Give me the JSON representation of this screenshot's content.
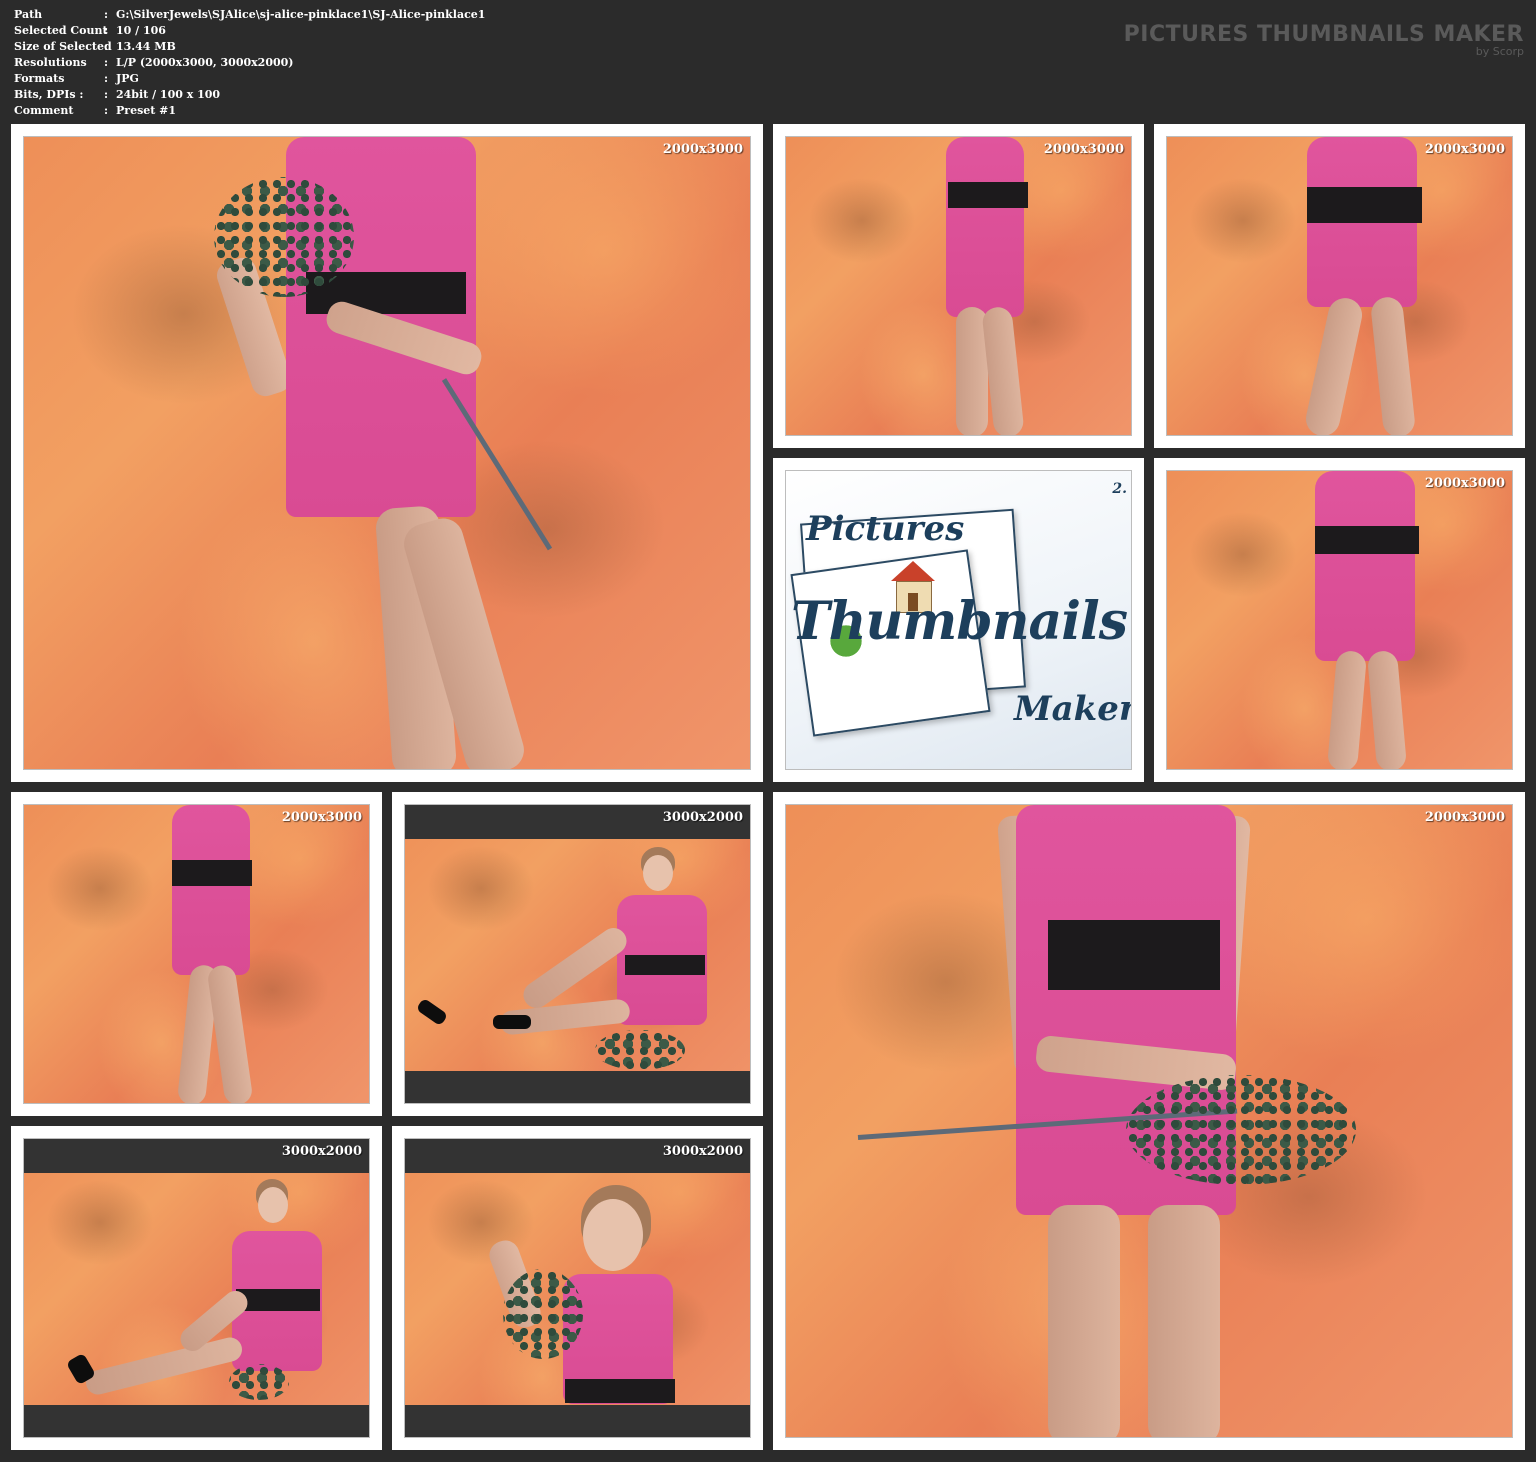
{
  "info": {
    "rows": [
      {
        "key": "Path",
        "value": "G:\\SilverJewels\\SJAlice\\sj-alice-pinklace1\\SJ-Alice-pinklace1"
      },
      {
        "key": "Selected Count",
        "value": "10 / 106"
      },
      {
        "key": "Size of Selected",
        "value": "13.44 MB"
      },
      {
        "key": "Resolutions",
        "value": "L/P (2000x3000, 3000x2000)"
      },
      {
        "key": "Formats",
        "value": "JPG"
      },
      {
        "key": "Bits, DPIs :",
        "value": "24bit / 100 x 100"
      },
      {
        "key": "Comment",
        "value": "Preset #1"
      }
    ],
    "separator": ":"
  },
  "brand": {
    "title": "PICTURES THUMBNAILS MAKER",
    "subtitle": "by Scorp"
  },
  "logo": {
    "line1": "Pictures",
    "line2": "Thumbnails",
    "line3": "Maker",
    "version": "2."
  },
  "thumbnails": [
    {
      "resolution": "2000x3000"
    },
    {
      "resolution": "2000x3000"
    },
    {
      "resolution": "2000x3000"
    },
    {
      "resolution": "2000x3000"
    },
    {
      "resolution": "2000x3000"
    },
    {
      "resolution": "3000x2000"
    },
    {
      "resolution": "2000x3000"
    },
    {
      "resolution": "3000x2000"
    },
    {
      "resolution": "3000x2000"
    }
  ],
  "colors": {
    "background": "#2b2b2b",
    "frame": "#ffffff",
    "brand": "#5a5a5a",
    "band": "#333333",
    "photo_backdrop": "#ee8f58",
    "dress": "#d94b93"
  }
}
